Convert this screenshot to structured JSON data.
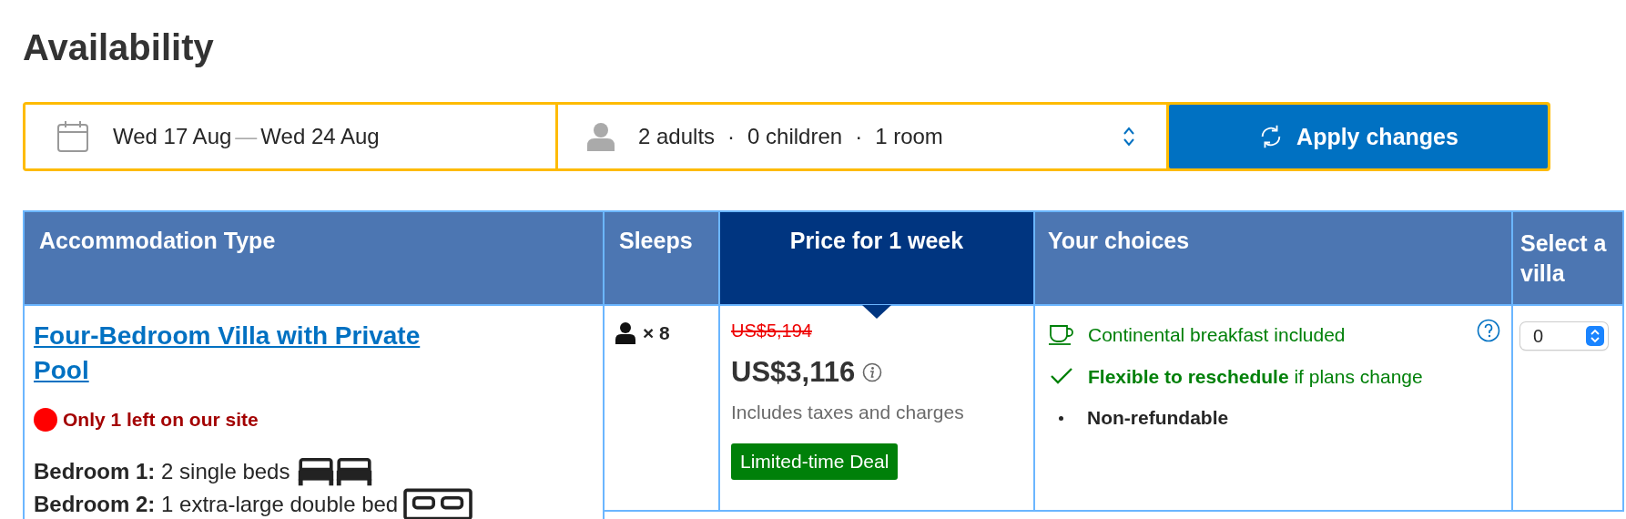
{
  "title": "Availability",
  "search": {
    "dates": {
      "start": "Wed 17 Aug",
      "separator": "—",
      "end": "Wed 24 Aug"
    },
    "guests": {
      "parts": [
        "2 adults",
        "0 children",
        "1 room"
      ],
      "separator": "·"
    },
    "apply_button": "Apply changes"
  },
  "table": {
    "columns": [
      {
        "label": "Accommodation Type",
        "selected": false
      },
      {
        "label": "Sleeps",
        "selected": false
      },
      {
        "label": "Price for 1 week",
        "selected": true
      },
      {
        "label": "Your choices",
        "selected": false
      },
      {
        "label": "Select a villa",
        "selected": false
      }
    ],
    "rows": [
      {
        "name": "Four-Bedroom Villa with Private Pool",
        "availability": "Only 1 left on our site",
        "beds": [
          {
            "label": "Bedroom 1:",
            "detail": "2 single beds",
            "icons": [
              {
                "kind": "single"
              },
              {
                "kind": "single"
              }
            ]
          },
          {
            "label": "Bedroom 2:",
            "detail": "1 extra-large double bed",
            "icons": [
              {
                "kind": "double"
              }
            ]
          }
        ],
        "sleeps": "× 8",
        "price": {
          "original": "US$5,194",
          "current": "US$3,116",
          "note": "Includes taxes and charges",
          "deal": "Limited-time Deal"
        },
        "choices": [
          {
            "kind": "meal",
            "text": "Continental breakfast included"
          },
          {
            "kind": "check",
            "text": "**Flexible to reschedule** if plans change"
          },
          {
            "kind": "bullet",
            "text": "Non-refundable"
          }
        ],
        "quantity": "0"
      }
    ]
  }
}
